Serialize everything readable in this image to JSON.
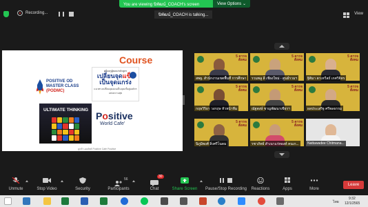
{
  "banner": {
    "text": "You are viewing นิพัฒน์_COACH's screen",
    "view_options": "View Options ⌄"
  },
  "topbar": {
    "recording": "Recording...",
    "talking": "นิพัฒน์_COACH is talking...",
    "view": "View"
  },
  "slide": {
    "course_word": "Course",
    "podmc_line1": "POSITIVE OD",
    "podmc_line2": "MASTER CLASS",
    "podmc_line3": "(PODMC)",
    "book_header": "คู่มือครูผู้สอน/หลักสูตร",
    "book_title_pre": "เปลี่ยนจุด",
    "book_title_accent": "แข็ง",
    "book_title_line2": "เป็นจุดแกร่ง",
    "book_sub": "แนวทางเปลี่ยนจุดอ่อนเป็นจุดแข็งสู่องค์กรแห่งความสุข",
    "ultimate": "ULTIMATE THINKING",
    "pwc_main_pre": "P",
    "pwc_main_accent": "o",
    "pwc_main_rest": "sitive",
    "pwc_sub": "World Cafe'",
    "footer": "ลูกค้า-ผลลัพธ์ Positive Cafe Positive"
  },
  "participants": [
    {
      "name": "สพฐ. สำนักงานเขตพื้นที่ การศึกษา"
    },
    {
      "name": "รวมพลู ลี เชียงใหม่ - ศูนย์รวมฯ"
    },
    {
      "name": "ฐิติมา ตาเทวีสถ์ เกศวิจิตร"
    },
    {
      "name": "กฤษวิริยา วงกฤษ หัวหน้าทีม"
    },
    {
      "name": "ณัฐพงษ์ ชาญพัฒนาเชียรฯ"
    },
    {
      "name": "ผลประเสริฐ ศรีพลธรรม"
    },
    {
      "name": "นิภูมิพงศ์ ลิ่งศรีโนดม"
    },
    {
      "name": "รชาภัทย์ สำเนาแร่ทองค์ คนเก..."
    },
    {
      "name": "Nattawadee Chitmana..."
    }
  ],
  "toolbar": {
    "unmute": "Unmute",
    "stop_video": "Stop Video",
    "security": "Security",
    "participants": "Participants",
    "participants_count": "56",
    "chat": "Chat",
    "chat_badge": "30",
    "share_screen": "Share Screen",
    "pause_recording": "Pause/Stop Recording",
    "reactions": "Reactions",
    "apps": "Apps",
    "more": "More",
    "leave": "Leave"
  },
  "taskbar": {
    "time": "9:32",
    "date": "12/1/2565",
    "lang": "ไทย"
  }
}
